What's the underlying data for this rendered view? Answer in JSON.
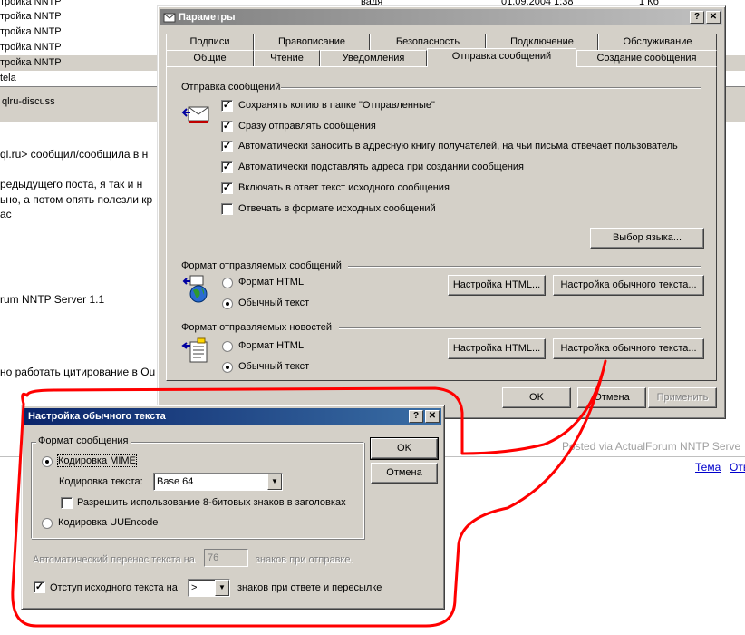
{
  "background": {
    "rows": [
      {
        "subject": "тройка NNTP",
        "author": "вадя",
        "date": "01.09.2004 1:38",
        "size": "1 Кб"
      },
      {
        "subject": "тройка NNTP"
      },
      {
        "subject": "тройка NNTP"
      },
      {
        "subject": "тройка NNTP"
      },
      {
        "subject": "тройка NNTP"
      },
      {
        "subject": "tela"
      }
    ],
    "group_label": "qlru-discuss",
    "body_lines": [
      "ql.ru> сообщил/сообщила в н",
      "редыдущего поста, я так и н",
      "ьно, а потом опять полезли кр",
      "ас",
      "rum NNTP Server 1.1",
      "но работать цитирование в Ou"
    ],
    "posted": "Posted via ActualForum NNTP Serve",
    "links": [
      "Тема",
      "Отв"
    ]
  },
  "params_dialog": {
    "title": "Параметры",
    "tabs_row1": [
      "Подписи",
      "Правописание",
      "Безопасность",
      "Подключение",
      "Обслуживание"
    ],
    "tabs_row2": [
      "Общие",
      "Чтение",
      "Уведомления",
      "Отправка сообщений",
      "Создание сообщения"
    ],
    "selected_tab": "Отправка сообщений",
    "send_group": "Отправка сообщений",
    "options": [
      {
        "label": "Сохранять копию в папке \"Отправленные\"",
        "checked": true
      },
      {
        "label": "Сразу отправлять сообщения",
        "checked": true
      },
      {
        "label": "Автоматически заносить в адресную книгу получателей, на чьи письма отвечает пользователь",
        "checked": true
      },
      {
        "label": "Автоматически подставлять адреса при создании сообщения",
        "checked": true
      },
      {
        "label": "Включать в ответ текст исходного сообщения",
        "checked": true
      },
      {
        "label": "Отвечать в формате исходных сообщений",
        "checked": false
      }
    ],
    "lang_button": "Выбор языка...",
    "mail_format_group": "Формат отправляемых сообщений",
    "news_format_group": "Формат отправляемых новостей",
    "radio_html": "Формат HTML",
    "radio_plain": "Обычный текст",
    "mail_selected": "plain",
    "news_selected": "plain",
    "html_settings_button": "Настройка HTML...",
    "plain_settings_button": "Настройка обычного текста...",
    "ok": "OK",
    "cancel": "Отмена",
    "apply": "Применить"
  },
  "plain_dialog": {
    "title": "Настройка обычного текста",
    "format_group": "Формат сообщения",
    "mime_label": "Кодировка MIME",
    "encoding_label": "Кодировка текста:",
    "encoding_value": "Base 64",
    "allow_8bit_label": "Разрешить использование 8-битовых знаков в заголовках",
    "allow_8bit_checked": false,
    "uuencode_label": "Кодировка UUEncode",
    "selected": "mime",
    "wrap_prefix": "Автоматический перенос текста на",
    "wrap_value": "76",
    "wrap_suffix": "знаков при отправке.",
    "indent_prefix": "Отступ исходного текста на",
    "indent_checked": true,
    "indent_value": ">",
    "indent_suffix": "знаков при ответе и пересылке",
    "ok": "OK",
    "cancel": "Отмена"
  },
  "annotation_color": "#ff0000"
}
